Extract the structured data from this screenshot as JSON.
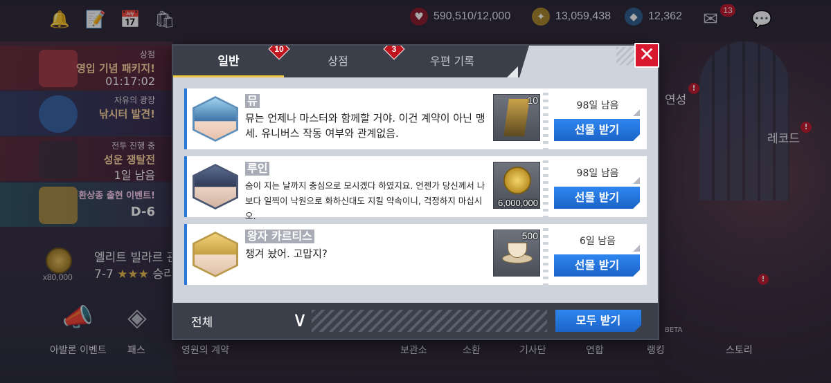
{
  "topbar": {
    "stamina": "590,510/12,000",
    "gold": "13,059,438",
    "gems": "12,362",
    "mail_badge": "13"
  },
  "left_banners": [
    {
      "tag": "상점",
      "title": "영입 기념 패키지!",
      "sub": "01:17:02"
    },
    {
      "tag": "자유의 광장",
      "title": "낚시터 발견!",
      "sub": ""
    },
    {
      "tag": "전투 진행 중",
      "title": "성운 쟁탈전",
      "sub": "1일 남음"
    },
    {
      "tag": "",
      "title": "환상종 출현 이벤트!",
      "sub": "D-6"
    }
  ],
  "elite": {
    "title": "엘리트 빌라르 관",
    "stage": "7-7",
    "stars": "★★★",
    "result": "승리",
    "reward": "x80,000"
  },
  "bottom_nav": [
    "아발론 이벤트",
    "패스",
    "영원의 계약",
    "보관소",
    "소환",
    "기사단",
    "연합",
    "랭킹",
    "스토리"
  ],
  "right_side": {
    "label_1": "연성",
    "label_2": "레코드",
    "beta": "BETA"
  },
  "modal": {
    "tabs": [
      {
        "label": "일반",
        "badge": "10"
      },
      {
        "label": "상점",
        "badge": "3"
      },
      {
        "label": "우편 기록",
        "badge": ""
      }
    ],
    "close_symbol": "✕",
    "mails": [
      {
        "sender": "뮤",
        "message": "뮤는 언제나 마스터와 함께할 거야. 이건 계약이 아닌 맹세. 유니버스 작동 여부와 관계없음.",
        "item_qty": "10",
        "expire": "98일 남음",
        "button": "선물 받기"
      },
      {
        "sender": "루인",
        "message": "숨이 지는 날까지 충심으로 모시겠다 하였지요. 언젠가 당신께서 나보다 일찍이 낙원으로 화하신대도 지킬 약속이니, 걱정하지 마십시오.",
        "item_qty": "6,000,000",
        "expire": "98일 남음",
        "button": "선물 받기"
      },
      {
        "sender": "왕자 카르티스",
        "message": "챙겨 놨어. 고맙지?",
        "item_qty": "500",
        "expire": "6일 남음",
        "button": "선물 받기"
      }
    ],
    "footer": {
      "filter": "전체",
      "claim_all": "모두 받기"
    }
  },
  "colors": {
    "accent_blue": "#2a77d8",
    "close_red": "#d8182e",
    "tab_gold": "#f0c43a"
  }
}
